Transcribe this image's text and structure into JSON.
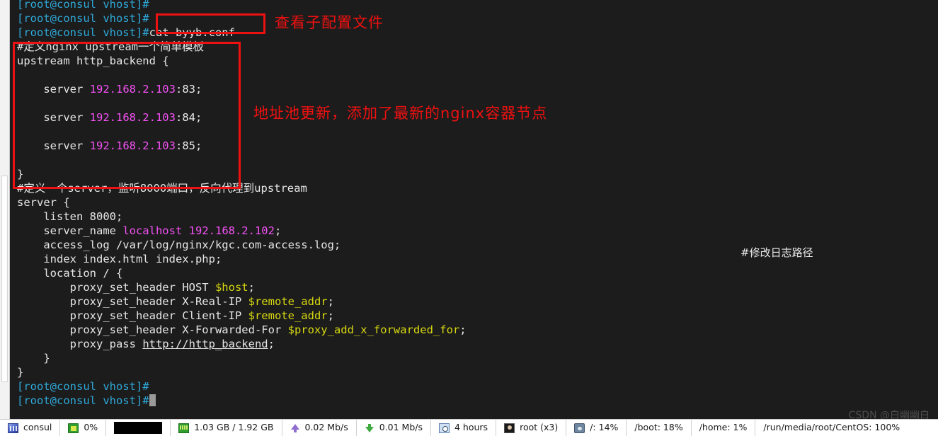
{
  "terminal": {
    "prompt_string": "[root@consul vhost]#",
    "lines": [
      {
        "type": "prompt",
        "prompt": "[root@consul vhost]#",
        "command": ""
      },
      {
        "type": "prompt",
        "prompt": "[root@consul vhost]#",
        "command": ""
      },
      {
        "type": "prompt",
        "prompt": "[root@consul vhost]#",
        "command": "cat byyb.conf"
      },
      {
        "type": "comment",
        "text": "#定义nginx upstream一个简单模板"
      },
      {
        "type": "code",
        "text": "upstream http_backend {"
      },
      {
        "type": "blank",
        "text": ""
      },
      {
        "type": "server",
        "indent": "    server ",
        "address": "192.168.2.103",
        "port": ":83;"
      },
      {
        "type": "blank",
        "text": ""
      },
      {
        "type": "server",
        "indent": "    server ",
        "address": "192.168.2.103",
        "port": ":84;"
      },
      {
        "type": "blank",
        "text": ""
      },
      {
        "type": "server",
        "indent": "    server ",
        "address": "192.168.2.103",
        "port": ":85;"
      },
      {
        "type": "blank",
        "text": ""
      },
      {
        "type": "code",
        "text": "}"
      },
      {
        "type": "comment",
        "text": "#定义一个server，监听8000端口，反向代理到upstream"
      },
      {
        "type": "code",
        "text": "server {"
      },
      {
        "type": "code",
        "text": "    listen 8000;"
      },
      {
        "type": "servername",
        "prefix": "    server_name ",
        "host": "localhost",
        "ip": "192.168.2.102",
        "suffix": ";"
      },
      {
        "type": "code",
        "text": "    access_log /var/log/nginx/kgc.com-access.log;"
      },
      {
        "type": "code",
        "text": "    index index.html index.php;"
      },
      {
        "type": "code",
        "text": "    location / {"
      },
      {
        "type": "header",
        "prefix": "        proxy_set_header HOST ",
        "var": "$host",
        "suffix": ";"
      },
      {
        "type": "header",
        "prefix": "        proxy_set_header X-Real-IP ",
        "var": "$remote_addr",
        "suffix": ";"
      },
      {
        "type": "header",
        "prefix": "        proxy_set_header Client-IP ",
        "var": "$remote_addr",
        "suffix": ";"
      },
      {
        "type": "header",
        "prefix": "        proxy_set_header X-Forwarded-For ",
        "var": "$proxy_add_x_forwarded_for",
        "suffix": ";"
      },
      {
        "type": "proxypass",
        "prefix": "        proxy_pass ",
        "url": "http://http_backend",
        "suffix": ";"
      },
      {
        "type": "code",
        "text": "    }"
      },
      {
        "type": "code",
        "text": "}"
      },
      {
        "type": "prompt",
        "prompt": "[root@consul vhost]#",
        "command": ""
      },
      {
        "type": "prompt_cursor",
        "prompt": "[root@consul vhost]#",
        "command": ""
      }
    ],
    "inline_note": "#修改日志路径",
    "colors": {
      "background": "#1c1c1c",
      "foreground": "#e6e6e6",
      "prompt": "#2fa8d8",
      "ip_address": "#f451f4",
      "nginx_variable": "#d7d711",
      "cursor": "#9a9a9a"
    }
  },
  "annotations": {
    "command_note": "查看子配置文件",
    "upstream_note": "地址池更新，添加了最新的nginx容器节点",
    "color": "#f01010"
  },
  "watermark": "CSDN @白幽幽白",
  "statusbar": {
    "items": [
      {
        "icon": "consul-icon",
        "label": "consul"
      },
      {
        "icon": "cpu-icon",
        "label": "0%"
      },
      {
        "icon": "cpu-graph",
        "label": ""
      },
      {
        "icon": "ram-icon",
        "label": "1.03 GB / 1.92 GB"
      },
      {
        "icon": "upload-icon",
        "label": "0.02 Mb/s"
      },
      {
        "icon": "download-icon",
        "label": "0.01 Mb/s"
      },
      {
        "icon": "clock-icon",
        "label": "4 hours"
      },
      {
        "icon": "user-icon",
        "label": "root (x3)"
      },
      {
        "icon": "disk-icon",
        "label": "/: 14%"
      },
      {
        "icon": "none",
        "label": "/boot: 18%"
      },
      {
        "icon": "none",
        "label": "/home: 1%"
      },
      {
        "icon": "none",
        "label": "/run/media/root/CentOS: 100%"
      }
    ]
  }
}
